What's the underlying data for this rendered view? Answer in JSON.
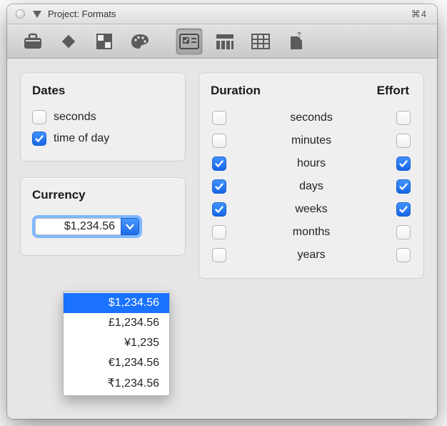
{
  "titlebar": {
    "title": "Project: Formats",
    "shortcut": "⌘4"
  },
  "toolbar": {
    "items": [
      {
        "name": "briefcase-icon",
        "active": false
      },
      {
        "name": "diamond-icon",
        "active": false
      },
      {
        "name": "grid-icon",
        "active": false
      },
      {
        "name": "palette-icon",
        "active": false
      },
      {
        "name": "checkbox-panel-icon",
        "active": true
      },
      {
        "name": "table-columns-icon",
        "active": false
      },
      {
        "name": "table-icon",
        "active": false
      },
      {
        "name": "export-icon",
        "active": false
      }
    ]
  },
  "dates": {
    "heading": "Dates",
    "items": [
      {
        "label": "seconds",
        "checked": false
      },
      {
        "label": "time of day",
        "checked": true
      }
    ]
  },
  "currency": {
    "heading": "Currency",
    "value": "$1,234.56",
    "options": [
      "$1,234.56",
      "£1,234.56",
      "¥1,235",
      "€1,234.56",
      "₹1,234.56"
    ],
    "selected_index": 0
  },
  "duration_effort": {
    "heading_duration": "Duration",
    "heading_effort": "Effort",
    "rows": [
      {
        "label": "seconds",
        "duration": false,
        "effort": false
      },
      {
        "label": "minutes",
        "duration": false,
        "effort": false
      },
      {
        "label": "hours",
        "duration": true,
        "effort": true
      },
      {
        "label": "days",
        "duration": true,
        "effort": true
      },
      {
        "label": "weeks",
        "duration": true,
        "effort": true
      },
      {
        "label": "months",
        "duration": false,
        "effort": false
      },
      {
        "label": "years",
        "duration": false,
        "effort": false
      }
    ]
  }
}
